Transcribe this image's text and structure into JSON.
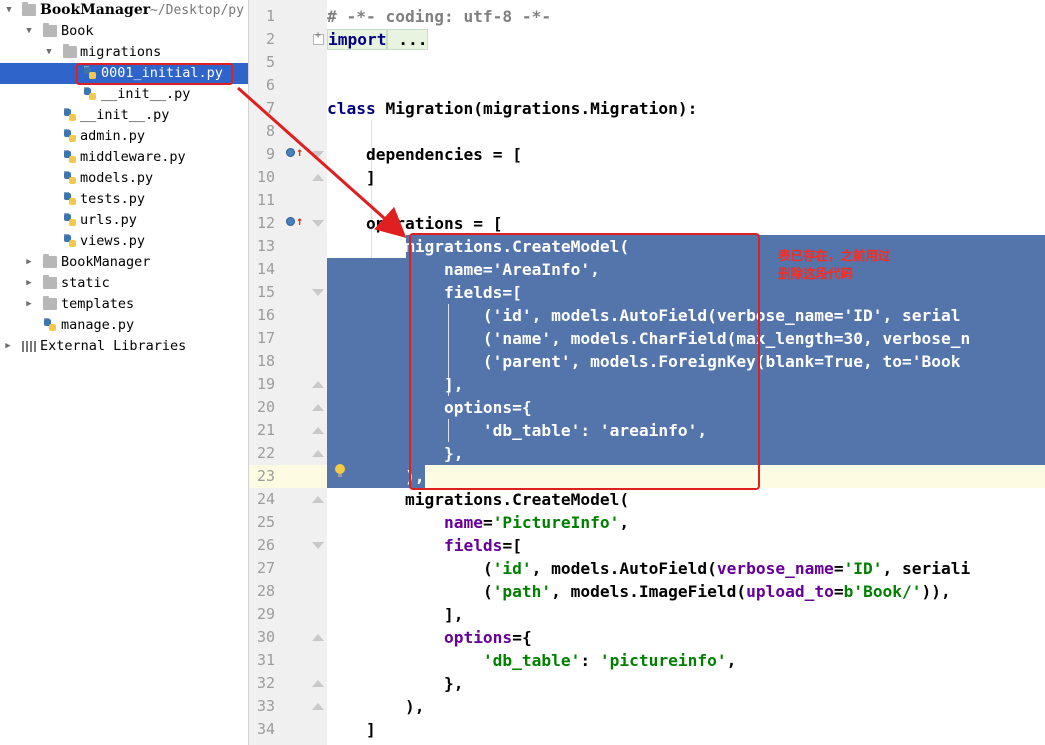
{
  "project_tree": {
    "root": {
      "label": "BookManager",
      "path": "~/Desktop/py"
    },
    "items": [
      {
        "label": "Book"
      },
      {
        "label": "migrations"
      },
      {
        "label": "0001_initial.py"
      },
      {
        "label": "__init__.py"
      },
      {
        "label": "__init__.py"
      },
      {
        "label": "admin.py"
      },
      {
        "label": "middleware.py"
      },
      {
        "label": "models.py"
      },
      {
        "label": "tests.py"
      },
      {
        "label": "urls.py"
      },
      {
        "label": "views.py"
      },
      {
        "label": "BookManager"
      },
      {
        "label": "static"
      },
      {
        "label": "templates"
      },
      {
        "label": "manage.py"
      },
      {
        "label": "External Libraries"
      }
    ]
  },
  "editor": {
    "line_numbers": [
      "1",
      "2",
      "5",
      "6",
      "7",
      "8",
      "9",
      "10",
      "11",
      "12",
      "13",
      "14",
      "15",
      "16",
      "17",
      "18",
      "19",
      "20",
      "21",
      "22",
      "23",
      "24",
      "25",
      "26",
      "27",
      "28",
      "29",
      "30",
      "31",
      "32",
      "33",
      "34"
    ],
    "lines": [
      "# -*- coding: utf-8 -*-",
      "import ...",
      "",
      "",
      "class Migration(migrations.Migration):",
      "",
      "    dependencies = [",
      "    ]",
      "",
      "    operations = [",
      "        migrations.CreateModel(",
      "            name='AreaInfo',",
      "            fields=[",
      "                ('id', models.AutoField(verbose_name='ID', serial",
      "                ('name', models.CharField(max_length=30, verbose_n",
      "                ('parent', models.ForeignKey(blank=True, to='Book",
      "            ],",
      "            options={",
      "                'db_table': 'areainfo',",
      "            },",
      "        ),",
      "        migrations.CreateModel(",
      "            name='PictureInfo',",
      "            fields=[",
      "                ('id', models.AutoField(verbose_name='ID', seriali",
      "                ('path', models.ImageField(upload_to=b'Book/')),",
      "            ],",
      "            options={",
      "                'db_table': 'pictureinfo',",
      "            },",
      "        ),",
      "    ]"
    ]
  },
  "annotation": {
    "line1": "表已存在，之前用过",
    "line2": "删除这段代码"
  },
  "colors": {
    "selection": "#5474ac",
    "tree_selection": "#2f65ca",
    "annotation_red": "#e02020",
    "keyword": "#000080",
    "string": "#008000",
    "param": "#660099"
  }
}
